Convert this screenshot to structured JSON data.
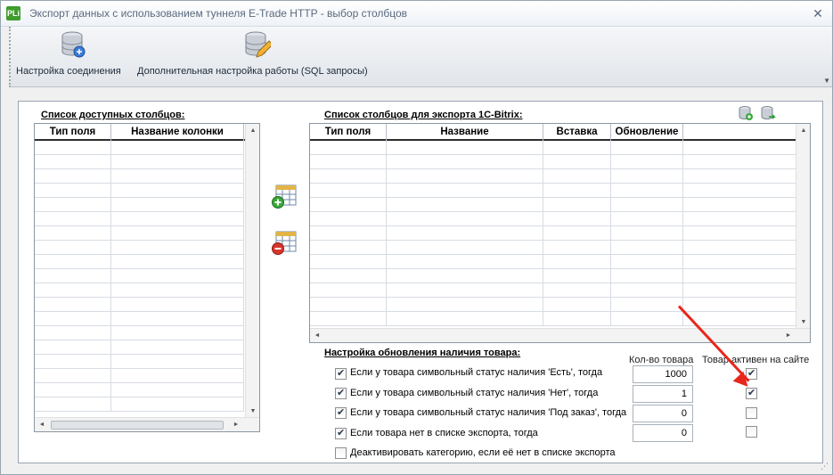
{
  "window": {
    "app_icon_text": "PLi",
    "title": "Экспорт данных с использованием туннеля E-Trade HTTP - выбор столбцов",
    "close_glyph": "✕"
  },
  "toolbar": {
    "connection_label": "Настройка соединения",
    "connection_icon": "database-connect-icon",
    "advanced_label": "Дополнительная настройка работы (SQL запросы)",
    "advanced_icon": "database-edit-icon"
  },
  "available_columns": {
    "title": "Список доступных столбцов:",
    "headers": [
      "Тип поля",
      "Название колонки"
    ],
    "rows": []
  },
  "export_columns": {
    "title": "Список столбцов для экспорта 1C-Bitrix:",
    "headers": [
      "Тип поля",
      "Название",
      "Вставка",
      "Обновление",
      ""
    ],
    "rows": []
  },
  "buttons": {
    "add_column_icon": "add-column-icon",
    "remove_column_icon": "remove-column-icon",
    "db_add_icon": "database-add-icon",
    "db_export_icon": "database-export-icon"
  },
  "availability": {
    "title": "Настройка обновления наличия товара:",
    "qty_header": "Кол-во товара",
    "active_header": "Товар активен на сайте",
    "rows": [
      {
        "label": "Если у товара символьный статус наличия 'Есть', тогда",
        "enabled": true,
        "qty": "1000",
        "active": true
      },
      {
        "label": "Если у товара символьный статус наличия 'Нет', тогда",
        "enabled": true,
        "qty": "1",
        "active": true
      },
      {
        "label": "Если у товара символьный статус наличия 'Под заказ', тогда",
        "enabled": true,
        "qty": "0",
        "active": false
      },
      {
        "label": "Если товара нет в списке экспорта, тогда",
        "enabled": true,
        "qty": "0",
        "active": false
      }
    ],
    "deactivate_label": "Деактивировать категорию, если её нет в списке экспорта",
    "deactivate_checked": false
  },
  "colors": {
    "annotation_arrow": "#e8261c",
    "app_icon": "#3f9c2e"
  }
}
